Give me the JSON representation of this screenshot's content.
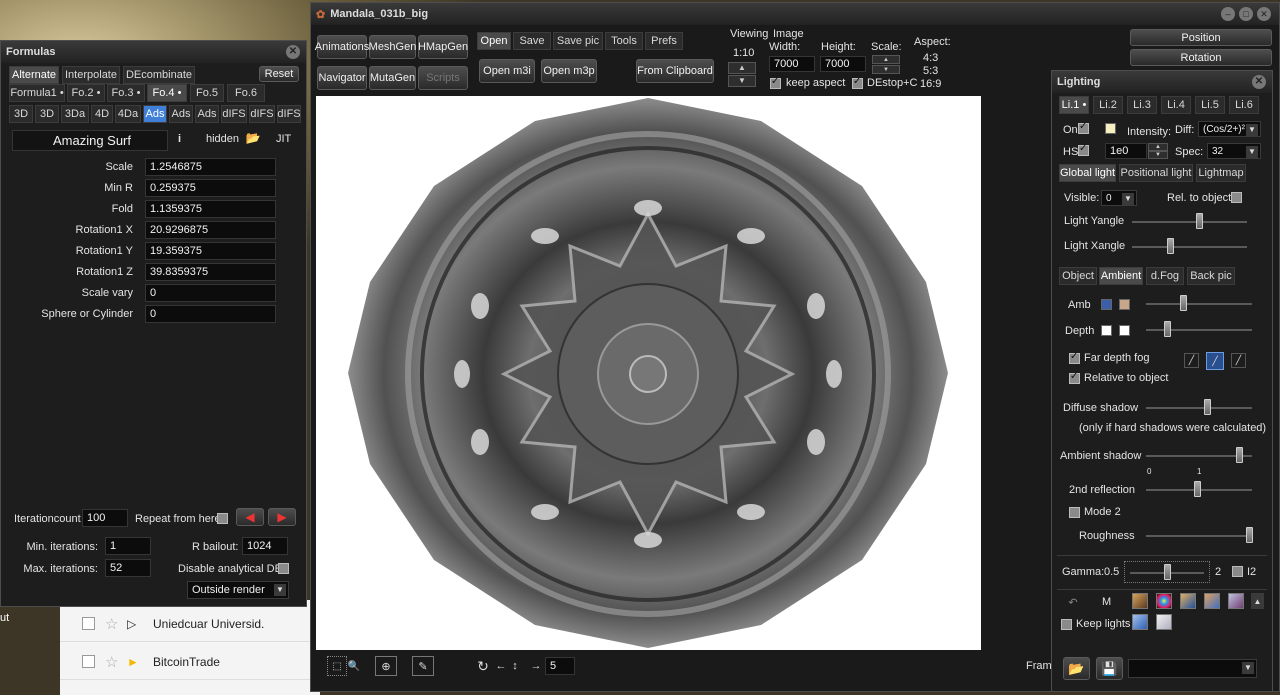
{
  "main_title": "Mandala_031b_big",
  "gmail": {
    "rows": [
      {
        "sender": "Uniedcuar Universid."
      },
      {
        "sender": "BitcoinTrade"
      }
    ]
  },
  "toolbar": {
    "left_buttons": [
      "Animations",
      "MeshGen",
      "HMapGen",
      "Navigator",
      "MutaGen",
      "Scripts"
    ],
    "tabs": [
      "Open",
      "Save",
      "Save pic",
      "Tools",
      "Prefs"
    ],
    "open_m3i": "Open m3i",
    "open_m3p": "Open m3p",
    "from_clipboard": "From Clipboard",
    "viewing_label": "Viewing",
    "viewing_value": "1:10",
    "image_label": "Image",
    "width_label": "Width:",
    "width_value": "7000",
    "height_label": "Height:",
    "height_value": "7000",
    "scale_label": "Scale:",
    "aspect_label": "Aspect:",
    "aspects": [
      "4:3",
      "5:3",
      "16:9"
    ],
    "keep_aspect": "keep aspect",
    "destop": "DEstop+C"
  },
  "right_panel": {
    "position": "Position",
    "rotation": "Rotation"
  },
  "bottom_bar": {
    "frame_value": "5",
    "fram_label": "Fram"
  },
  "formulas": {
    "title": "Formulas",
    "tabs1": [
      "Alternate",
      "Interpolate",
      "DEcombinate"
    ],
    "reset": "Reset",
    "tabs2": [
      "Formula1 •",
      "Fo.2 •",
      "Fo.3 •",
      "Fo.4 •",
      "Fo.5",
      "Fo.6"
    ],
    "tabs3": [
      "3D",
      "3D",
      "3Da",
      "4D",
      "4Da",
      "Ads",
      "Ads",
      "Ads",
      "dIFS",
      "dIFS",
      "dIFS"
    ],
    "formula_name": "Amazing Surf",
    "info": "i",
    "hidden": "hidden",
    "jit": "JIT",
    "params": [
      {
        "label": "Scale",
        "value": "1.2546875"
      },
      {
        "label": "Min R",
        "value": "0.259375"
      },
      {
        "label": "Fold",
        "value": "1.1359375"
      },
      {
        "label": "Rotation1 X",
        "value": "20.9296875"
      },
      {
        "label": "Rotation1 Y",
        "value": "19.359375"
      },
      {
        "label": "Rotation1 Z",
        "value": "39.8359375"
      },
      {
        "label": "Scale vary",
        "value": "0"
      },
      {
        "label": "Sphere or Cylinder",
        "value": "0"
      }
    ],
    "iterationcount_label": "Iterationcount",
    "iterationcount": "100",
    "repeat_from_here": "Repeat from here",
    "min_iter_label": "Min. iterations:",
    "min_iter": "1",
    "max_iter_label": "Max. iterations:",
    "max_iter": "52",
    "rbailout_label": "R bailout:",
    "rbailout": "1024",
    "disable_de": "Disable analytical DE",
    "outside_render": "Outside render"
  },
  "lighting": {
    "title": "Lighting",
    "light_tabs": [
      "Li.1 •",
      "Li.2",
      "Li.3",
      "Li.4",
      "Li.5",
      "Li.6"
    ],
    "on": "On",
    "intensity": "Intensity:",
    "diff": "Diff:",
    "diff_value": "(Cos/2+)²",
    "hs": "HS",
    "hs_value": "1e0",
    "spec": "Spec:",
    "spec_value": "32",
    "gtabs": [
      "Global light",
      "Positional light",
      "Lightmap"
    ],
    "visible": "Visible:",
    "visible_value": "0",
    "rel_obj": "Rel. to object:",
    "light_yangle": "Light Yangle",
    "light_xangle": "Light Xangle",
    "light_yangle_level": 0.58,
    "light_xangle_level": 0.33,
    "atabs": [
      "Object",
      "Ambient",
      "d.Fog",
      "Back pic"
    ],
    "amb": "Amb",
    "depth": "Depth",
    "far_depth_fog": "Far depth fog",
    "relative_to_object": "Relative to object",
    "diffuse_shadow": "Diffuse shadow",
    "diffuse_note": "(only if hard shadows were calculated)",
    "ambient_shadow": "Ambient shadow",
    "ambient_ticks": [
      "0",
      "1"
    ],
    "second_reflection": "2nd reflection",
    "mode2": "Mode 2",
    "roughness": "Roughness",
    "gamma_label": "Gamma:",
    "gamma_min": "0.5",
    "gamma_max": "2",
    "i2": "I2",
    "m": "M",
    "keep_lights": "Keep lights",
    "colors": {
      "amb1": "#3a5fa8",
      "amb2": "#c8a68a",
      "depth1": "#ffffff",
      "depth2": "#ffffff",
      "intensity": "#f6efc0"
    }
  }
}
